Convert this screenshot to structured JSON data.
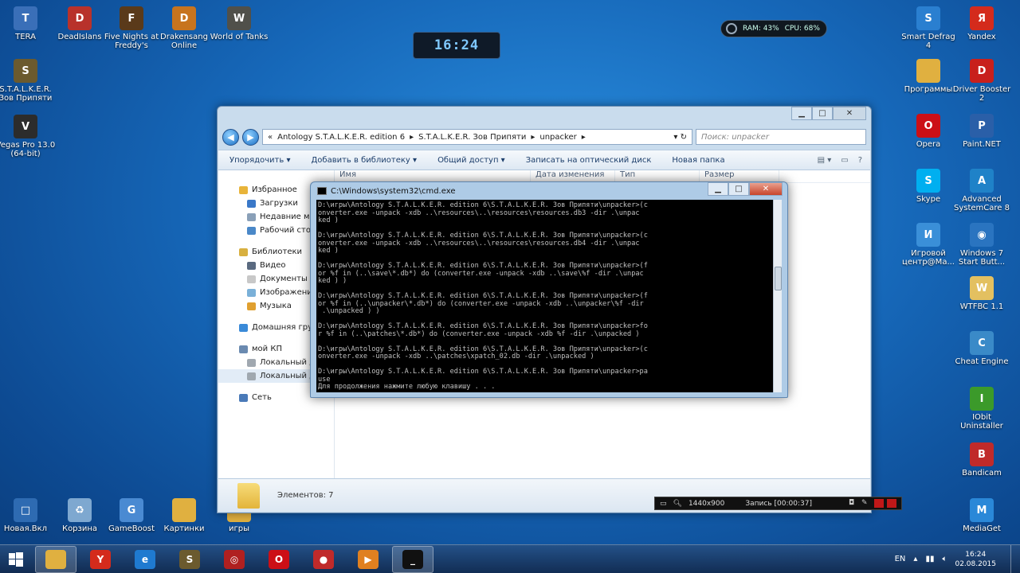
{
  "desktop": {
    "left_icons": [
      {
        "label": "TERA",
        "color": "#3a6fb8",
        "glyph": "T"
      },
      {
        "label": "DeadIslans",
        "color": "#b8322b",
        "glyph": "D"
      },
      {
        "label": "Five Nights at Freddy's",
        "color": "#5a3a1a",
        "glyph": "F"
      },
      {
        "label": "Drakensang Online",
        "color": "#c7741e",
        "glyph": "D"
      },
      {
        "label": "World of Tanks",
        "color": "#50504a",
        "glyph": "W"
      }
    ],
    "left_column": [
      {
        "label": "S.T.A.L.K.E.R. Зов Припяти",
        "color": "#6b5a2e",
        "glyph": "S"
      },
      {
        "label": "Vegas Pro 13.0 (64-bit)",
        "color": "#2c2c2c",
        "glyph": "V"
      }
    ],
    "bottom_icons": [
      {
        "label": "Новая.Вкл",
        "color": "#2e6bb2",
        "glyph": "□"
      },
      {
        "label": "Корзина",
        "color": "#7ea8d0",
        "glyph": "♻"
      },
      {
        "label": "GameBoost",
        "color": "#4a8ad2",
        "glyph": "G"
      },
      {
        "label": "Картинки",
        "color": "#e0b040",
        "glyph": ""
      },
      {
        "label": "игры",
        "color": "#e0b040",
        "glyph": ""
      }
    ],
    "right_icons": [
      {
        "label": "Smart Defrag 4",
        "color": "#2a7fd0",
        "glyph": "S"
      },
      {
        "label": "Yandex",
        "color": "#d42b1c",
        "glyph": "Я"
      },
      {
        "label": "Программы",
        "color": "#e0b040",
        "glyph": ""
      },
      {
        "label": "Driver Booster 2",
        "color": "#c8201c",
        "glyph": "D"
      },
      {
        "label": "Opera",
        "color": "#cc0f16",
        "glyph": "O"
      },
      {
        "label": "Paint.NET",
        "color": "#2a5fa8",
        "glyph": "P"
      },
      {
        "label": "Skype",
        "color": "#00aff0",
        "glyph": "S"
      },
      {
        "label": "Advanced SystemCare 8",
        "color": "#1f82c8",
        "glyph": "A"
      },
      {
        "label": "Игровой центр@Ма...",
        "color": "#3a8fd8",
        "glyph": "И"
      },
      {
        "label": "Windows 7 Start Butt...",
        "color": "#2a74c0",
        "glyph": "◉"
      },
      {
        "label": "WTFBC 1.1",
        "color": "#e3c060",
        "glyph": "W"
      },
      {
        "label": "Cheat Engine",
        "color": "#3a8ac8",
        "glyph": "C"
      },
      {
        "label": "IObit Uninstaller",
        "color": "#3b9a2a",
        "glyph": "I"
      },
      {
        "label": "Bandicam",
        "color": "#c02a2a",
        "glyph": "B"
      },
      {
        "label": "MediaGet",
        "color": "#2a88d8",
        "glyph": "M"
      }
    ]
  },
  "clock_gadget": {
    "time": "16:24"
  },
  "sysmon": {
    "ram": "RAM: 43%",
    "cpu": "CPU: 68%"
  },
  "explorer": {
    "crumbs": [
      "«",
      "Antology S.T.A.L.K.E.R. edition 6",
      "▸",
      "S.T.A.L.K.E.R. Зов Припяти",
      "▸",
      "unpacker",
      "▸"
    ],
    "search_placeholder": "Поиск: unpacker",
    "commands": [
      "Упорядочить ▾",
      "Добавить в библиотеку ▾",
      "Общий доступ ▾",
      "Записать на оптический диск",
      "Новая папка"
    ],
    "columns": [
      "Имя",
      "Дата изменения",
      "Тип",
      "Размер"
    ],
    "nav": [
      {
        "label": "Избранное",
        "type": "group",
        "color": "#e8b43a"
      },
      {
        "label": "Загрузки",
        "type": "sub",
        "color": "#3a78c8"
      },
      {
        "label": "Недавние места",
        "type": "sub",
        "color": "#8aa0b8"
      },
      {
        "label": "Рабочий стол",
        "type": "sub",
        "color": "#4a88c8"
      },
      {
        "label": "Библиотеки",
        "type": "group",
        "color": "#d8b040"
      },
      {
        "label": "Видео",
        "type": "sub",
        "color": "#5a6a80"
      },
      {
        "label": "Документы",
        "type": "sub",
        "color": "#c8c8c8"
      },
      {
        "label": "Изображения",
        "type": "sub",
        "color": "#7ab0d8"
      },
      {
        "label": "Музыка",
        "type": "sub",
        "color": "#e0a030"
      },
      {
        "label": "Домашняя группа",
        "type": "group",
        "color": "#3a8ad8"
      },
      {
        "label": "мой КП",
        "type": "group",
        "color": "#6a8ab0"
      },
      {
        "label": "Локальный диск (C:)",
        "type": "sub",
        "color": "#a0a8b0"
      },
      {
        "label": "Локальный диск (D:)",
        "type": "sub sel",
        "color": "#a0a8b0"
      },
      {
        "label": "Сеть",
        "type": "group",
        "color": "#4a7ab8"
      }
    ],
    "status": "Элементов: 7"
  },
  "cmd": {
    "title": "C:\\Windows\\system32\\cmd.exe",
    "lines": [
      "D:\\игры\\Antology S.T.A.L.K.E.R. edition 6\\S.T.A.L.K.E.R. Зов Припяти\\unpacker>(c",
      "onverter.exe -unpack -xdb ..\\resources\\..\\resources\\resources.db3 -dir .\\unpac",
      "ked )",
      "",
      "D:\\игры\\Antology S.T.A.L.K.E.R. edition 6\\S.T.A.L.K.E.R. Зов Припяти\\unpacker>(c",
      "onverter.exe -unpack -xdb ..\\resources\\..\\resources\\resources.db4 -dir .\\unpac",
      "ked )",
      "",
      "D:\\игры\\Antology S.T.A.L.K.E.R. edition 6\\S.T.A.L.K.E.R. Зов Припяти\\unpacker>(f",
      "or %f in (..\\save\\*.db*) do (converter.exe -unpack -xdb ..\\save\\%f -dir .\\unpac",
      "ked ) )",
      "",
      "D:\\игры\\Antology S.T.A.L.K.E.R. edition 6\\S.T.A.L.K.E.R. Зов Припяти\\unpacker>(f",
      "or %f in (..\\unpacker\\*.db*) do (converter.exe -unpack -xdb ..\\unpacker\\%f -dir",
      " .\\unpacked ) )",
      "",
      "D:\\игры\\Antology S.T.A.L.K.E.R. edition 6\\S.T.A.L.K.E.R. Зов Припяти\\unpacker>fo",
      "r %f in (..\\patches\\*.db*) do (converter.exe -unpack -xdb %f -dir .\\unpacked )",
      "",
      "D:\\игры\\Antology S.T.A.L.K.E.R. edition 6\\S.T.A.L.K.E.R. Зов Припяти\\unpacker>(c",
      "onverter.exe -unpack -xdb ..\\patches\\xpatch_02.db -dir .\\unpacked )",
      "",
      "D:\\игры\\Antology S.T.A.L.K.E.R. edition 6\\S.T.A.L.K.E.R. Зов Припяти\\unpacker>pa",
      "use",
      "Для продолжения нажмите любую клавишу . . ."
    ]
  },
  "recbar": {
    "resolution": "1440x900",
    "recording": "Запись [00:00:37]"
  },
  "taskbar": {
    "items": [
      {
        "name": "explorer",
        "color": "#e0b040",
        "glyph": "",
        "active": true
      },
      {
        "name": "yandex-browser",
        "color": "#d42b1c",
        "glyph": "Y",
        "active": false
      },
      {
        "name": "ie",
        "color": "#1f7ad0",
        "glyph": "e",
        "active": false
      },
      {
        "name": "stalker",
        "color": "#6b5a2e",
        "glyph": "S",
        "active": false
      },
      {
        "name": "game",
        "color": "#b02020",
        "glyph": "◎",
        "active": false
      },
      {
        "name": "opera",
        "color": "#cc0f16",
        "glyph": "O",
        "active": false
      },
      {
        "name": "bandicam",
        "color": "#c02a2a",
        "glyph": "●",
        "active": false
      },
      {
        "name": "player",
        "color": "#e08020",
        "glyph": "▶",
        "active": false
      },
      {
        "name": "cmd",
        "color": "#111111",
        "glyph": "_",
        "active": true
      }
    ],
    "lang": "EN",
    "time": "16:24",
    "date": "02.08.2015"
  }
}
